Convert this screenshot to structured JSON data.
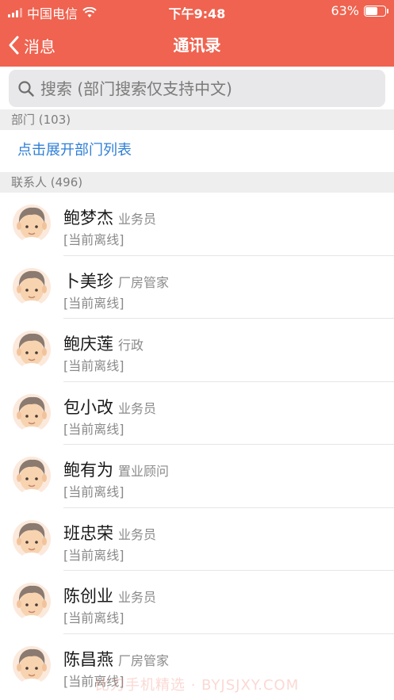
{
  "status_bar": {
    "carrier": "中国电信",
    "time": "下午9:48",
    "battery": "63%",
    "battery_level": 0.63
  },
  "nav": {
    "back_label": "消息",
    "title": "通讯录"
  },
  "search": {
    "placeholder": "搜索 (部门搜索仅支持中文)"
  },
  "departments": {
    "header": "部门 (103)",
    "expand_label": "点击展开部门列表"
  },
  "contacts": {
    "header": "联系人 (496)",
    "items": [
      {
        "name": "鲍梦杰",
        "role": "业务员",
        "status": "[当前离线]"
      },
      {
        "name": "卜美珍",
        "role": "厂房管家",
        "status": "[当前离线]"
      },
      {
        "name": "鲍庆莲",
        "role": "行政",
        "status": "[当前离线]"
      },
      {
        "name": "包小改",
        "role": "业务员",
        "status": "[当前离线]"
      },
      {
        "name": "鲍有为",
        "role": "置业顾问",
        "status": "[当前离线]"
      },
      {
        "name": "班忠荣",
        "role": "业务员",
        "status": "[当前离线]"
      },
      {
        "name": "陈创业",
        "role": "业务员",
        "status": "[当前离线]"
      },
      {
        "name": "陈昌燕",
        "role": "厂房管家",
        "status": "[当前离线]"
      }
    ]
  },
  "watermark": "比刀手机精选 · BYJSJXY.COM",
  "colors": {
    "accent": "#ef6350",
    "link": "#2f7fd6"
  }
}
